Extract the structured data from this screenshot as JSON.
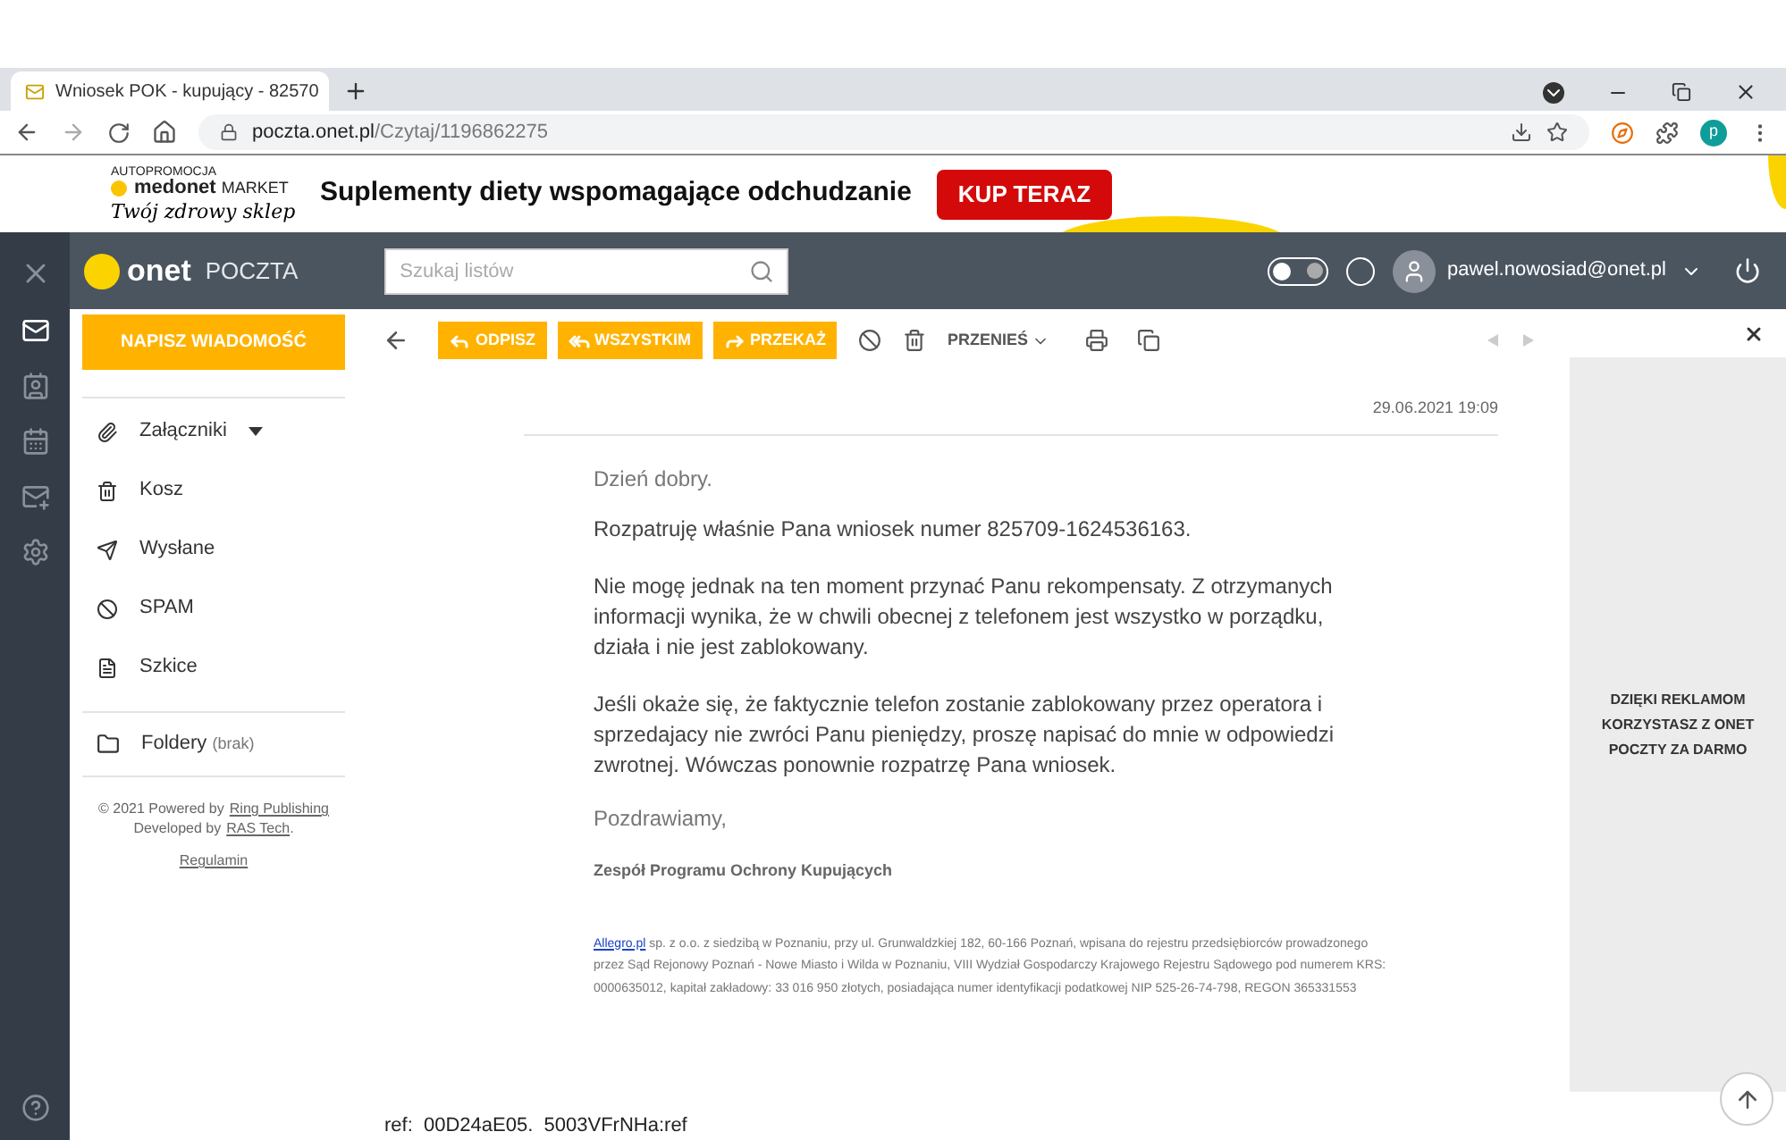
{
  "browser": {
    "tab_title": "Wniosek POK - kupujący - 82570",
    "url_host": "poczta.onet.pl",
    "url_path": "/Czytaj/1196862275",
    "profile_initial": "p"
  },
  "ad_banner": {
    "label": "AUTOPROMOCJA",
    "brand": "medonet",
    "brand_suffix": "MARKET",
    "tagline": "Twój zdrowy sklep",
    "headline": "Suplementy diety wspomagające odchudzanie",
    "cta": "KUP TERAZ"
  },
  "header": {
    "logo": "onet",
    "product": "POCZTA",
    "search_placeholder": "Szukaj listów",
    "dark_mode": false,
    "user": "pawel.nowosiad@onet.pl"
  },
  "rail": [
    {
      "kind": "close"
    },
    {
      "kind": "mail",
      "selected": true
    },
    {
      "kind": "contacts",
      "selected": false
    },
    {
      "kind": "calendar",
      "selected": false
    },
    {
      "kind": "newmail",
      "selected": false
    },
    {
      "kind": "settings",
      "selected": false
    },
    {
      "kind": "help"
    }
  ],
  "compose_button": "NAPISZ WIADOMOŚĆ",
  "toolbar": [
    {
      "kind": "reply",
      "label": "ODPISZ"
    },
    {
      "kind": "replyall",
      "label": "WSZYSTKIM"
    },
    {
      "kind": "forward",
      "label": "PRZEKAŻ"
    }
  ],
  "move_button": "PRZENIEŚ",
  "folders": [
    {
      "kind": "attachments",
      "label": "Załączniki",
      "dropdown": true
    },
    {
      "kind": "trash",
      "label": "Kosz",
      "dropdown": false
    },
    {
      "kind": "sent",
      "label": "Wysłane",
      "dropdown": false
    },
    {
      "kind": "spam",
      "label": "SPAM",
      "dropdown": false
    },
    {
      "kind": "drafts",
      "label": "Szkice",
      "dropdown": false
    }
  ],
  "custom_folders": {
    "label": "Foldery",
    "count": "(brak)"
  },
  "footer": {
    "copyright": "© 2021 Powered by",
    "ring_link": "Ring Publishing",
    "developed": "Developed by",
    "ras_link": "RAS Tech",
    "dot": ".",
    "terms": "Regulamin"
  },
  "message": {
    "date": "29.06.2021 19:09",
    "greeting": "Dzień dobry.",
    "paragraphs": [
      "Rozpatruję właśnie Pana wniosek numer 825709-1624536163.",
      "Nie mogę jednak na ten moment przynać Panu rekompensaty. Z otrzymanych informacji wynika, że w chwili obecnej z telefonem jest wszystko w porządku, działa i nie jest zablokowany.",
      "Jeśli okaże się, że faktycznie telefon zostanie zablokowany przez operatora i sprzedajacy nie zwróci Panu pieniędzy, proszę napisać do mnie w odpowiedzi zwrotnej. Wówczas ponownie rozpatrzę Pana wniosek."
    ],
    "closing": "Pozdrawiamy,",
    "signature": "Zespół Programu Ochrony Kupujących",
    "legal_link": "Allegro.pl",
    "legal_text": "sp. z o.o. z siedzibą w Poznaniu, przy ul. Grunwaldzkiej 182, 60-166 Poznań, wpisana do rejestru przedsiębiorców prowadzonego przez Sąd Rejonowy Poznań - Nowe Miasto i Wilda w Poznaniu, VIII Wydział Gospodarczy Krajowego Rejestru Sądowego pod numerem KRS: 0000635012, kapitał zakładowy: 33 016 950 złotych, posiadająca numer identyfikacji podatkowej NIP 525-26-74-798, REGON 365331553",
    "ref": "ref:  00D24aE05.  5003VFrNHa:ref"
  },
  "side_ad": {
    "text": "DZIĘKI REKLAMOM KORZYSTASZ Z ONET POCZTY ZA DARMO"
  }
}
